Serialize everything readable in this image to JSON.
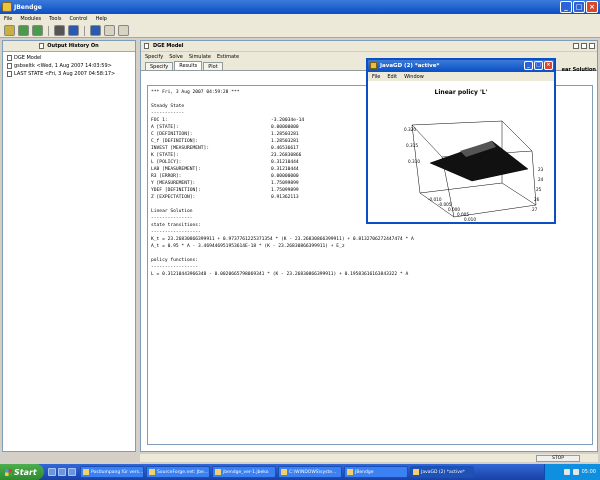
{
  "app": {
    "title": "JBendge"
  },
  "menubar": [
    "File",
    "Modules",
    "Tools",
    "Control",
    "Help"
  ],
  "left_panel": {
    "title": "Output History On",
    "items": [
      "DGE Model",
      "gsbseltk <Wed, 1 Aug 2007 14:03:59>",
      "LAST STATE <Fri, 3 Aug 2007 04:58:17>"
    ]
  },
  "dge": {
    "title": "DGE Model",
    "menu": [
      "Specify",
      "Solve",
      "Simulate",
      "Estimate"
    ],
    "tabs": [
      "Specify",
      "Results",
      "Plot"
    ],
    "active_tab": "Results",
    "right_label": "ear Solution",
    "header_line": "*** Fri, 3 Aug 2007 04:59:28 ***",
    "steady_state_title": "Steady State",
    "steady_state_rule": "------------",
    "steady_state": [
      {
        "name": "FOC 1:",
        "value": "-3.20034e-14"
      },
      {
        "name": "A [STATE]:",
        "value": "0.00000000"
      },
      {
        "name": "C [DEFINITION]:",
        "value": "1.28503281"
      },
      {
        "name": "C_f [DEFINITION]:",
        "value": "1.28503281"
      },
      {
        "name": "INVEST [MEASUREMENT]:",
        "value": "0.46536617"
      },
      {
        "name": "K [STATE]:",
        "value": "23.26830866"
      },
      {
        "name": "L [POLICY]:",
        "value": "0.31210444"
      },
      {
        "name": "LAB [MEASUREMENT]:",
        "value": "0.31210444"
      },
      {
        "name": "R3 [ERROR]:",
        "value": "0.00000000"
      },
      {
        "name": "Y [MEASUREMENT]:",
        "value": "1.75099899"
      },
      {
        "name": "YDEF [DEFINITION]:",
        "value": "1.75099899"
      },
      {
        "name": "Z [EXPECTATION]:",
        "value": "0.91362113"
      }
    ],
    "linear_title": "Linear Solution",
    "linear_rule": "---------------",
    "state_transitions_title": "state transitions:",
    "state_transitions_rule": "------------------",
    "transition_lines": [
      "K_t = 23.26830866399911 + 0.9737761225371354 * (K - 23.26830866399911) + 0.8132706272447474 * A",
      "A_t = 0.95 * A - 3.469446951953614E-18 * (K - 23.26830866399911) + E_z"
    ],
    "policy_title": "policy functions:",
    "policy_rule": "-----------------",
    "policy_lines": [
      "L = 0.31210443966348 - 0.0020665798069341 * (K - 23.26830866399911) + 0.19583616163843322 * A"
    ]
  },
  "javagd": {
    "title": "JavaGD (2) *active*",
    "menu": [
      "File",
      "Edit",
      "Window"
    ],
    "plot_title": "Linear policy 'L'",
    "z_ticks": [
      "0.320",
      "0.315",
      "0.310"
    ],
    "x_ticks": [
      "-0.010",
      "-0.005",
      "0.000",
      "0.005",
      "0.010"
    ],
    "y_ticks": [
      "23",
      "24",
      "25",
      "26",
      "27"
    ]
  },
  "status": {
    "stop_label": "STOP"
  },
  "taskbar": {
    "start_label": "Start",
    "tasks": [
      "Postlumpang für vers...",
      "SourceForge.net: Jbe...",
      "jbendge_ver-1.jbeko",
      "C:\\WINDOWS\\syste...",
      "JBendge",
      "JavaGD (2) *active*"
    ],
    "clock": "05:00"
  },
  "colors": {
    "titlebar": "#0a4fc4",
    "start": "#2f8a2f",
    "tray": "#0f8fe0",
    "plot_surface": "#111111"
  }
}
